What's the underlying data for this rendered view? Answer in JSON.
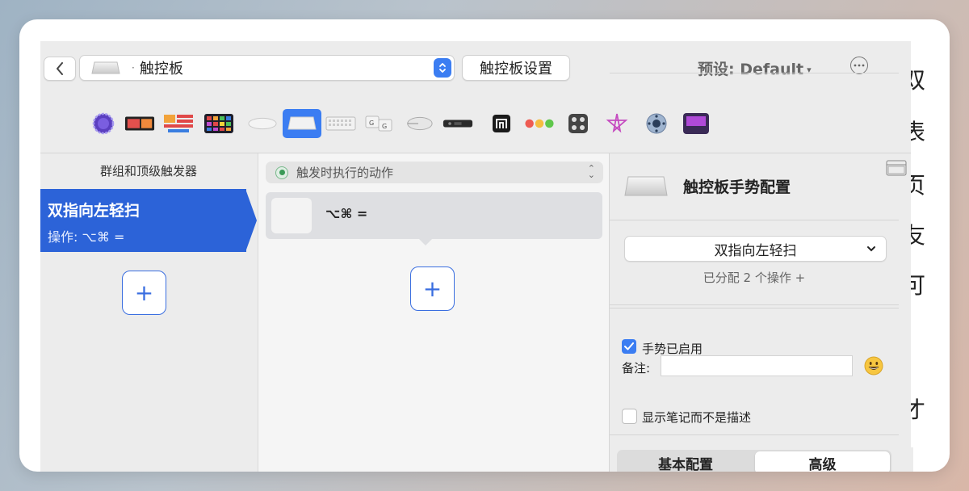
{
  "toolbar": {
    "device_name": "触控板",
    "device_prefix": "·",
    "settings_button": "触控板设置",
    "preset_label": "预设: Default",
    "preset_caret": "▾"
  },
  "device_bar": {
    "items": [
      "stream-deck-icon",
      "touch-bar-icon",
      "shortcuts-icon",
      "midi-icon",
      "magic-mouse-icon",
      "trackpad-icon",
      "keyboard-icon",
      "keys-icon",
      "mouse-icon",
      "siri-remote-icon",
      "notch-icon",
      "window-buttons-icon",
      "controller-icon",
      "drawing-icon",
      "settings-dial-icon",
      "other-app-icon"
    ],
    "active": "trackpad-icon"
  },
  "left": {
    "header": "群组和顶级触发器",
    "trigger_title": "双指向左轻扫",
    "trigger_subtitle": "操作: ⌥⌘ ="
  },
  "middle": {
    "action_select": "触发时执行的动作",
    "action_label": "⌥⌘ ="
  },
  "right": {
    "title": "触控板手势配置",
    "gesture_value": "双指向左轻扫",
    "assigned": "已分配 2 个操作 +",
    "enabled_label": "手势已启用",
    "enabled": true,
    "note_label": "备注:",
    "note_value": "",
    "show_notes_label": "显示笔记而不是描述",
    "show_notes": false,
    "tab_basic": "基本配置",
    "tab_advanced": "高级",
    "active_tab": "高级"
  },
  "background_text": [
    "双",
    "表",
    "页",
    "友",
    "可",
    "才"
  ],
  "colors": {
    "accent": "#3b7df2",
    "selection": "#2c63d8"
  }
}
